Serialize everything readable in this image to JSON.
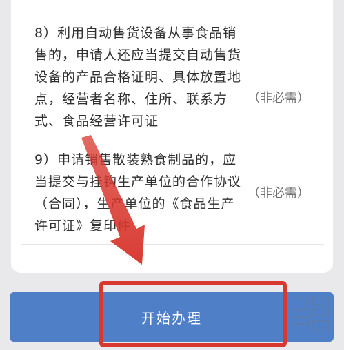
{
  "requirements": [
    {
      "number": "8",
      "text": "8）利用自动售货设备从事食品销售的，申请人还应当提交自动售货设备的产品合格证明、具体放置地点，经营者名称、住所、联系方式、食品经营许可证",
      "badge": "（非必需）"
    },
    {
      "number": "9",
      "text": "9）申请销售散装熟食制品的，应当提交与挂钩生产单位的合作协议（合同），生产单位的《食品生产许可证》复印件",
      "badge": "（非必需）"
    }
  ],
  "action": {
    "start_label": "开始办理"
  },
  "colors": {
    "button": "#4f7fc7",
    "annotation": "#d8382f"
  }
}
